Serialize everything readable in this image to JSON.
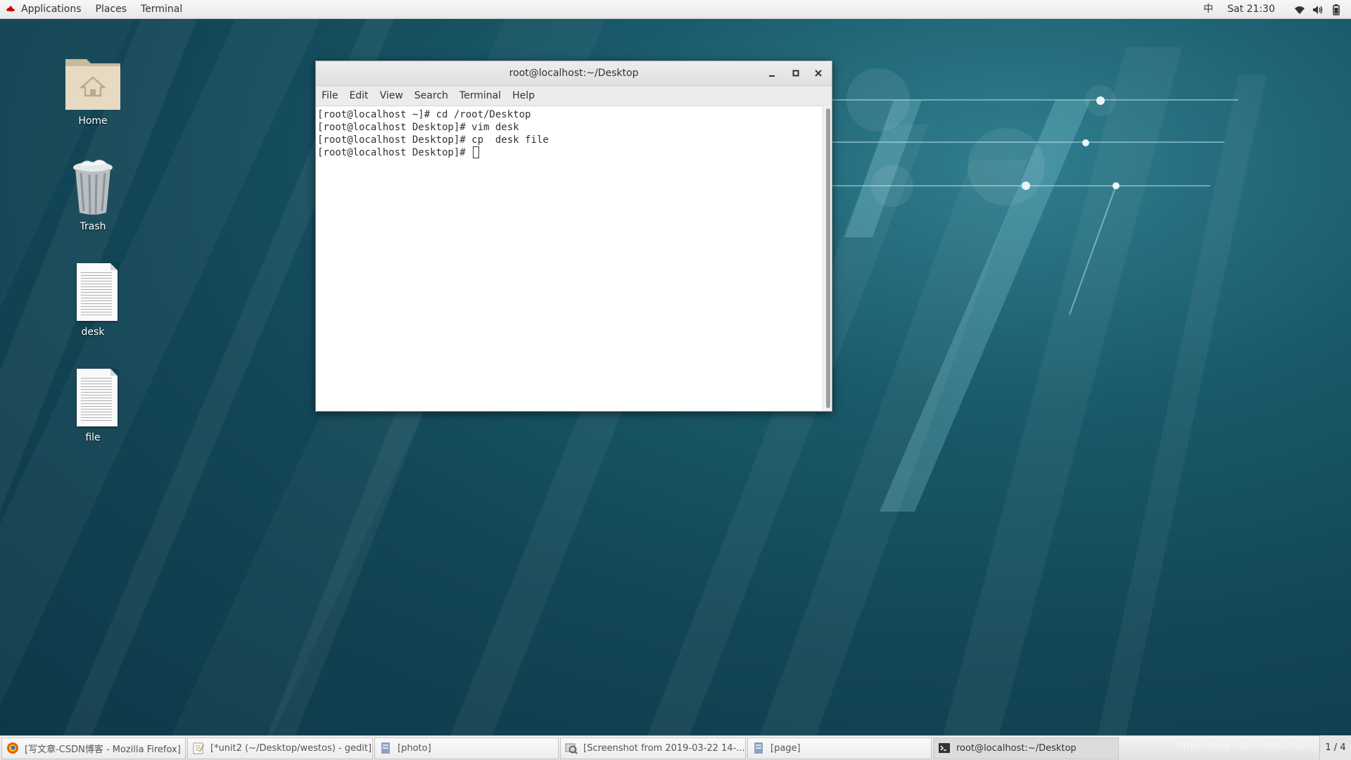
{
  "topbar": {
    "applications": "Applications",
    "places": "Places",
    "terminal": "Terminal",
    "input_method": "中",
    "clock": "Sat 21:30",
    "icons": [
      "wifi-icon",
      "volume-icon",
      "battery-icon"
    ]
  },
  "desktop": {
    "icons": [
      {
        "label": "Home",
        "icon": "home-folder-icon"
      },
      {
        "label": "Trash",
        "icon": "trash-icon"
      },
      {
        "label": "desk",
        "icon": "text-file-icon"
      },
      {
        "label": "file",
        "icon": "text-file-icon"
      }
    ]
  },
  "terminal_window": {
    "title": "root@localhost:~/Desktop",
    "menu": [
      "File",
      "Edit",
      "View",
      "Search",
      "Terminal",
      "Help"
    ],
    "lines": [
      "[root@localhost ~]# cd /root/Desktop",
      "[root@localhost Desktop]# vim desk",
      "[root@localhost Desktop]# cp  desk file",
      "[root@localhost Desktop]# "
    ]
  },
  "taskbar": {
    "tasks": [
      {
        "label": "[写文章-CSDN博客 - Mozilla Firefox]",
        "icon": "firefox-icon",
        "active": false
      },
      {
        "label": "[*unit2 (~/Desktop/westos) - gedit]",
        "icon": "gedit-icon",
        "active": false
      },
      {
        "label": "[photo]",
        "icon": "file-manager-icon",
        "active": false
      },
      {
        "label": "[Screenshot from 2019-03-22 14-...",
        "icon": "screenshot-icon",
        "active": false
      },
      {
        "label": "[page]",
        "icon": "file-manager-icon",
        "active": false
      },
      {
        "label": "root@localhost:~/Desktop",
        "icon": "terminal-icon",
        "active": true
      }
    ],
    "workspace": "1 / 4",
    "watermark": "https://blog.csdn.net/luchuang"
  }
}
